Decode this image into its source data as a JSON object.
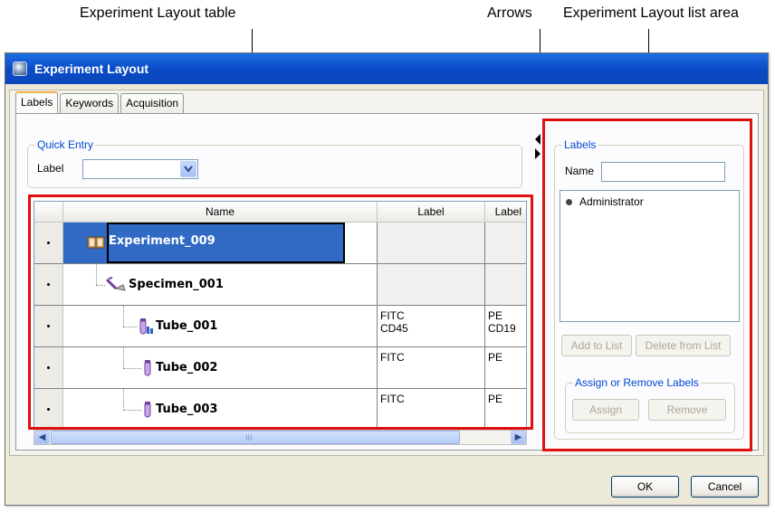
{
  "callouts": {
    "table": "Experiment Layout table",
    "arrows": "Arrows",
    "list_area": "Experiment Layout list area"
  },
  "window": {
    "title": "Experiment Layout"
  },
  "tabs": [
    {
      "label": "Labels",
      "active": true
    },
    {
      "label": "Keywords",
      "active": false
    },
    {
      "label": "Acquisition",
      "active": false
    }
  ],
  "quick_entry": {
    "legend": "Quick Entry",
    "label": "Label",
    "value": ""
  },
  "table": {
    "columns": [
      "Name",
      "Label",
      "Label"
    ],
    "rows": [
      {
        "name": "Experiment_009",
        "icon": "experiment-book-icon",
        "label1": "",
        "label2": "",
        "selected": true
      },
      {
        "name": "Specimen_001",
        "icon": "specimen-icon",
        "label1": "",
        "label2": ""
      },
      {
        "name": "Tube_001",
        "icon": "tube-running-icon",
        "label1": "FITC\nCD45",
        "label2": "PE\nCD19"
      },
      {
        "name": "Tube_002",
        "icon": "tube-icon",
        "label1": "FITC",
        "label2": "PE"
      },
      {
        "name": "Tube_003",
        "icon": "tube-icon",
        "label1": "FITC",
        "label2": "PE"
      }
    ],
    "scrollbar_grip": "III"
  },
  "labels_panel": {
    "legend": "Labels",
    "name_label": "Name",
    "name_value": "",
    "list_items": [
      "Administrator"
    ],
    "add_to_list": "Add to List",
    "delete_from_list": "Delete from List",
    "assign_group_legend": "Assign or Remove Labels",
    "assign": "Assign",
    "remove": "Remove"
  },
  "dialog_buttons": {
    "ok": "OK",
    "cancel": "Cancel"
  },
  "colors": {
    "highlight_red": "#e01010",
    "selection_blue": "#316ac5",
    "titlebar_blue": "#0a4bc8",
    "legend_blue": "#0046d5"
  }
}
